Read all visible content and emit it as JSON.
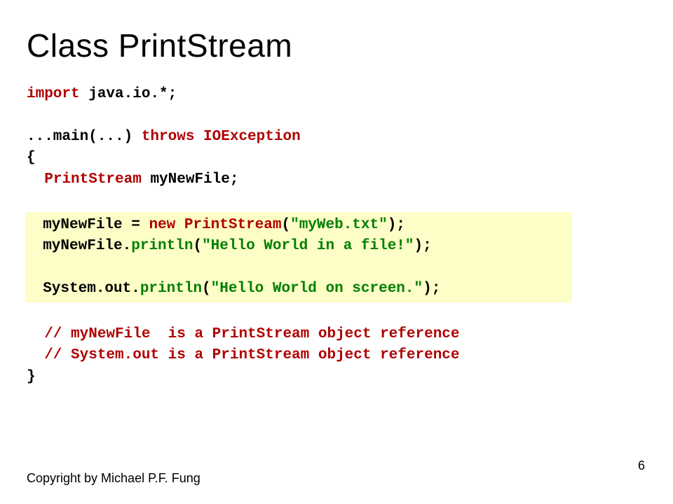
{
  "title": "Class PrintStream",
  "code": {
    "l1a": "import",
    "l1b": " java.io.*;",
    "l3a": "...main(...) ",
    "l3b": "throws IOException",
    "l4": "{",
    "l5a": "  ",
    "l5b": "PrintStream",
    "l5c": " myNewFile;",
    "hl1a": "  myNewFile = ",
    "hl1b": "new",
    "hl1c": " ",
    "hl1d": "PrintStream",
    "hl1e": "(",
    "hl1f": "\"myWeb.txt\"",
    "hl1g": ");",
    "hl2a": "  myNewFile.",
    "hl2b": "println",
    "hl2c": "(",
    "hl2d": "\"Hello World in a file!\"",
    "hl2e": ");",
    "hl4a": "  System.out.",
    "hl4b": "println",
    "hl4c": "(",
    "hl4d": "\"Hello World on screen.\"",
    "hl4e": ");",
    "c1": "  // myNewFile  is a PrintStream object reference",
    "c2": "  // System.out is a PrintStream object reference",
    "l_end": "}"
  },
  "footer": "Copyright by Michael P.F. Fung",
  "page": "6"
}
